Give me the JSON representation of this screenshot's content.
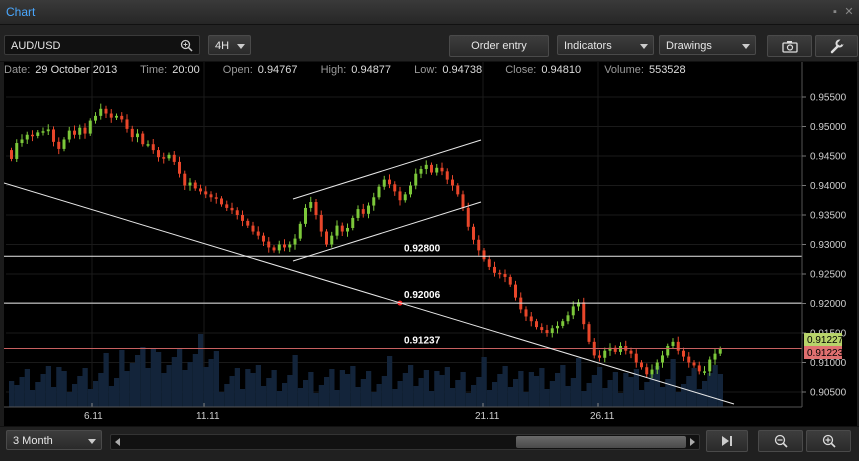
{
  "window": {
    "title": "Chart"
  },
  "toolbar": {
    "symbol": "AUD/USD",
    "timeframe": "4H",
    "order_entry": "Order entry",
    "indicators": "Indicators",
    "drawings": "Drawings"
  },
  "info": {
    "date_label": "Date:",
    "date": "29 October 2013",
    "time_label": "Time:",
    "time": "20:00",
    "open_label": "Open:",
    "open": "0.94767",
    "high_label": "High:",
    "high": "0.94877",
    "low_label": "Low:",
    "low": "0.94738",
    "close_label": "Close:",
    "close": "0.94810",
    "volume_label": "Volume:",
    "volume": "553528"
  },
  "bottom": {
    "period": "3 Month"
  },
  "colors": {
    "up": "#7cc83a",
    "down": "#e8462a",
    "accent": "#4aa8ff",
    "current_price_bg": "#b8d36a",
    "bid_price_bg": "#e07070"
  },
  "chart_data": {
    "type": "candlestick",
    "price_axis": [
      "0.95500",
      "0.95000",
      "0.94500",
      "0.94000",
      "0.93500",
      "0.93000",
      "0.92500",
      "0.92000",
      "0.91500",
      "0.91000",
      "0.90500"
    ],
    "ylim": [
      0.9025,
      0.9575
    ],
    "date_axis": [
      "6.11",
      "11.11",
      "21.11",
      "26.11"
    ],
    "current_price": "0.91227",
    "bid_price": "0.91223",
    "horizontal_levels": [
      {
        "price": 0.928,
        "label": "0.92800"
      },
      {
        "price": 0.92006,
        "label": "0.92006"
      },
      {
        "price": 0.91237,
        "label": "0.91237"
      }
    ],
    "closes": [
      0.9445,
      0.9472,
      0.9478,
      0.9486,
      0.9484,
      0.949,
      0.9492,
      0.9495,
      0.9474,
      0.9462,
      0.9478,
      0.9493,
      0.9486,
      0.9498,
      0.9488,
      0.951,
      0.9518,
      0.953,
      0.9522,
      0.9515,
      0.9518,
      0.9512,
      0.9496,
      0.9482,
      0.9488,
      0.947,
      0.947,
      0.946,
      0.9448,
      0.9446,
      0.9452,
      0.944,
      0.942,
      0.94,
      0.9405,
      0.9395,
      0.939,
      0.9385,
      0.938,
      0.9378,
      0.9368,
      0.9362,
      0.9358,
      0.935,
      0.934,
      0.9332,
      0.9322,
      0.9315,
      0.9305,
      0.9295,
      0.929,
      0.93,
      0.9295,
      0.93,
      0.931,
      0.9335,
      0.9362,
      0.9372,
      0.935,
      0.9322,
      0.93,
      0.9315,
      0.9332,
      0.9322,
      0.9328,
      0.9345,
      0.936,
      0.9352,
      0.9366,
      0.938,
      0.9398,
      0.941,
      0.9402,
      0.939,
      0.9375,
      0.9385,
      0.94,
      0.942,
      0.9428,
      0.9435,
      0.9422,
      0.943,
      0.9424,
      0.941,
      0.94,
      0.9385,
      0.9362,
      0.933,
      0.9308,
      0.929,
      0.9275,
      0.9262,
      0.9252,
      0.925,
      0.9245,
      0.9232,
      0.921,
      0.919,
      0.9178,
      0.917,
      0.916,
      0.9155,
      0.915,
      0.9158,
      0.9162,
      0.917,
      0.918,
      0.9195,
      0.9202,
      0.9165,
      0.9135,
      0.9112,
      0.9108,
      0.912,
      0.9125,
      0.9118,
      0.9128,
      0.912,
      0.9115,
      0.91,
      0.9092,
      0.908,
      0.9088,
      0.91,
      0.9112,
      0.9128,
      0.9135,
      0.912,
      0.911,
      0.91,
      0.9095,
      0.9085,
      0.9085,
      0.9105,
      0.9115,
      0.9123
    ]
  }
}
